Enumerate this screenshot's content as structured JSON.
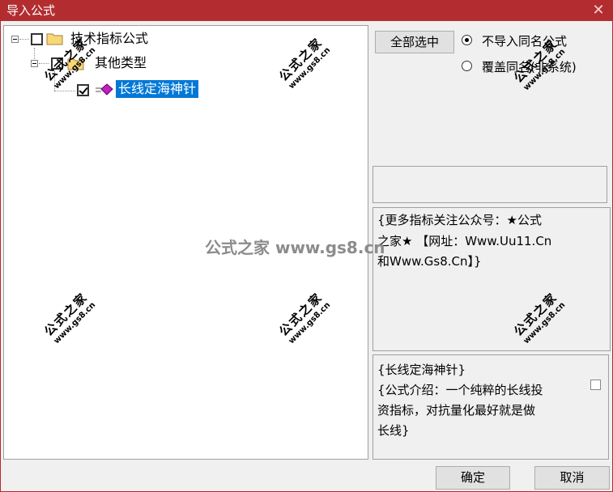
{
  "window": {
    "title": "导入公式",
    "close_glyph": "✕"
  },
  "tree": {
    "root": {
      "label": "技术指标公式",
      "checked": false
    },
    "child": {
      "label": "其他类型"
    },
    "leaf": {
      "label": "长线定海神针",
      "checked": true
    }
  },
  "controls": {
    "select_all_label": "全部选中",
    "radio_no_import": "不导入同名公式",
    "radio_overwrite": "覆盖同名(非系统)"
  },
  "info_box": {
    "lines": [
      "{更多指标关注公众号：★公式",
      "之家★ 【网址：Www.Uu11.Cn",
      "和Www.Gs8.Cn】}"
    ]
  },
  "desc_box": {
    "lines": [
      "{长线定海神针}",
      "{公式介绍：一个纯粹的长线投",
      "资指标，对抗量化最好就是做",
      "长线}"
    ]
  },
  "buttons": {
    "ok_label": "确定",
    "cancel_label": "取消"
  },
  "watermark": {
    "big": "公式之家",
    "small": "www.gs8.cn",
    "center_text": "公式之家 www.gs8.cn"
  }
}
